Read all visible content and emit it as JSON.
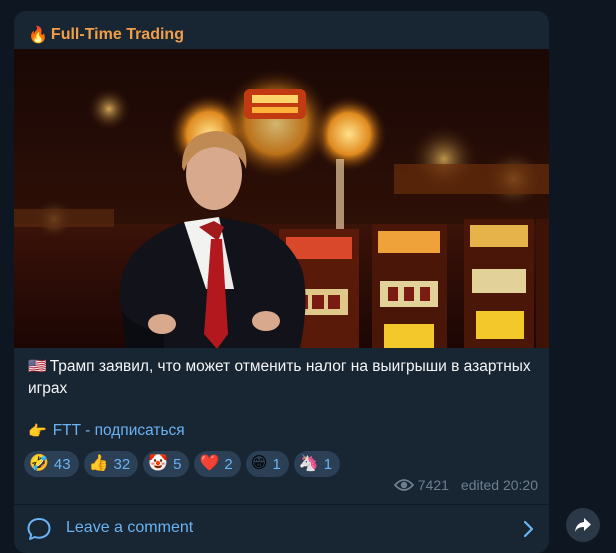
{
  "channel": {
    "icon": "fire-icon",
    "icon_glyph": "🔥",
    "name": "Full-Time Trading"
  },
  "post": {
    "image": "photo-man-in-suit-casino-slot-machines",
    "text_flag": "🇺🇸",
    "text": "Трамп заявил, что может отменить налог на выигрыши в азартных играх",
    "subscribe_pointer": "👉",
    "subscribe_link": "FTT - подписаться"
  },
  "reactions": [
    {
      "emoji": "🤣",
      "count": "43"
    },
    {
      "emoji": "👍",
      "count": "32"
    },
    {
      "emoji": "🤡",
      "count": "5"
    },
    {
      "emoji": "❤️",
      "count": "2"
    },
    {
      "emoji": "😁",
      "count": "1"
    },
    {
      "emoji": "🦄",
      "count": "1"
    }
  ],
  "meta": {
    "views_icon": "eye-icon",
    "views": "7421",
    "edited": "edited 20:20"
  },
  "comment": {
    "icon": "comment-bubble-icon",
    "label": "Leave a comment",
    "chevron": "chevron-right-icon"
  },
  "forward": {
    "icon": "forward-arrow-icon"
  },
  "colors": {
    "background": "#0e1621",
    "bubble": "#182533",
    "channel_name": "#f19e48",
    "link": "#6ab3f3",
    "meta": "#6d7f8f",
    "reaction_bg": "#2b3f55"
  }
}
